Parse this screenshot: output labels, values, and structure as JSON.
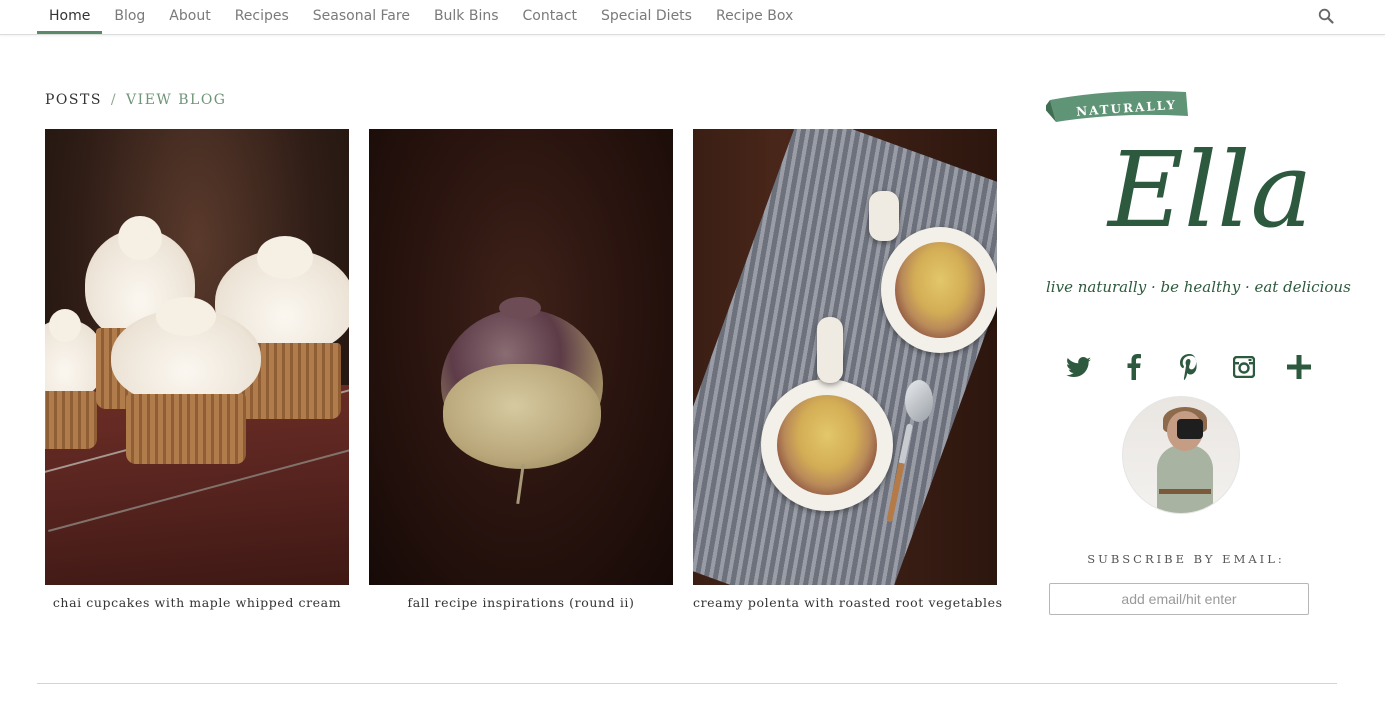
{
  "nav": {
    "items": [
      {
        "label": "Home",
        "active": true
      },
      {
        "label": "Blog"
      },
      {
        "label": "About"
      },
      {
        "label": "Recipes"
      },
      {
        "label": "Seasonal Fare"
      },
      {
        "label": "Bulk Bins"
      },
      {
        "label": "Contact"
      },
      {
        "label": "Special Diets"
      },
      {
        "label": "Recipe Box"
      }
    ],
    "search_icon": "search-icon"
  },
  "posts": {
    "label": "POSTS",
    "separator": "/",
    "view_blog": "VIEW BLOG",
    "items": [
      {
        "caption": "chai cupcakes with maple whipped cream",
        "image": "cupcakes-photo"
      },
      {
        "caption": "fall recipe inspirations (round ii)",
        "image": "turnip-photo"
      },
      {
        "caption": "creamy polenta with roasted root vegetables",
        "image": "polenta-bowls-photo"
      }
    ]
  },
  "sidebar": {
    "logo_banner": "NATURALLY",
    "logo_script": "Ella",
    "tagline": "live naturally · be healthy · eat delicious",
    "social": [
      "twitter-icon",
      "facebook-icon",
      "pinterest-icon",
      "instagram-icon",
      "plus-icon"
    ],
    "subscribe_label": "SUBSCRIBE BY EMAIL:",
    "email_placeholder": "add email/hit enter"
  },
  "colors": {
    "accent_green": "#5a8a6a",
    "logo_green": "#2d5a3e",
    "view_blog_green": "#6f9478"
  }
}
